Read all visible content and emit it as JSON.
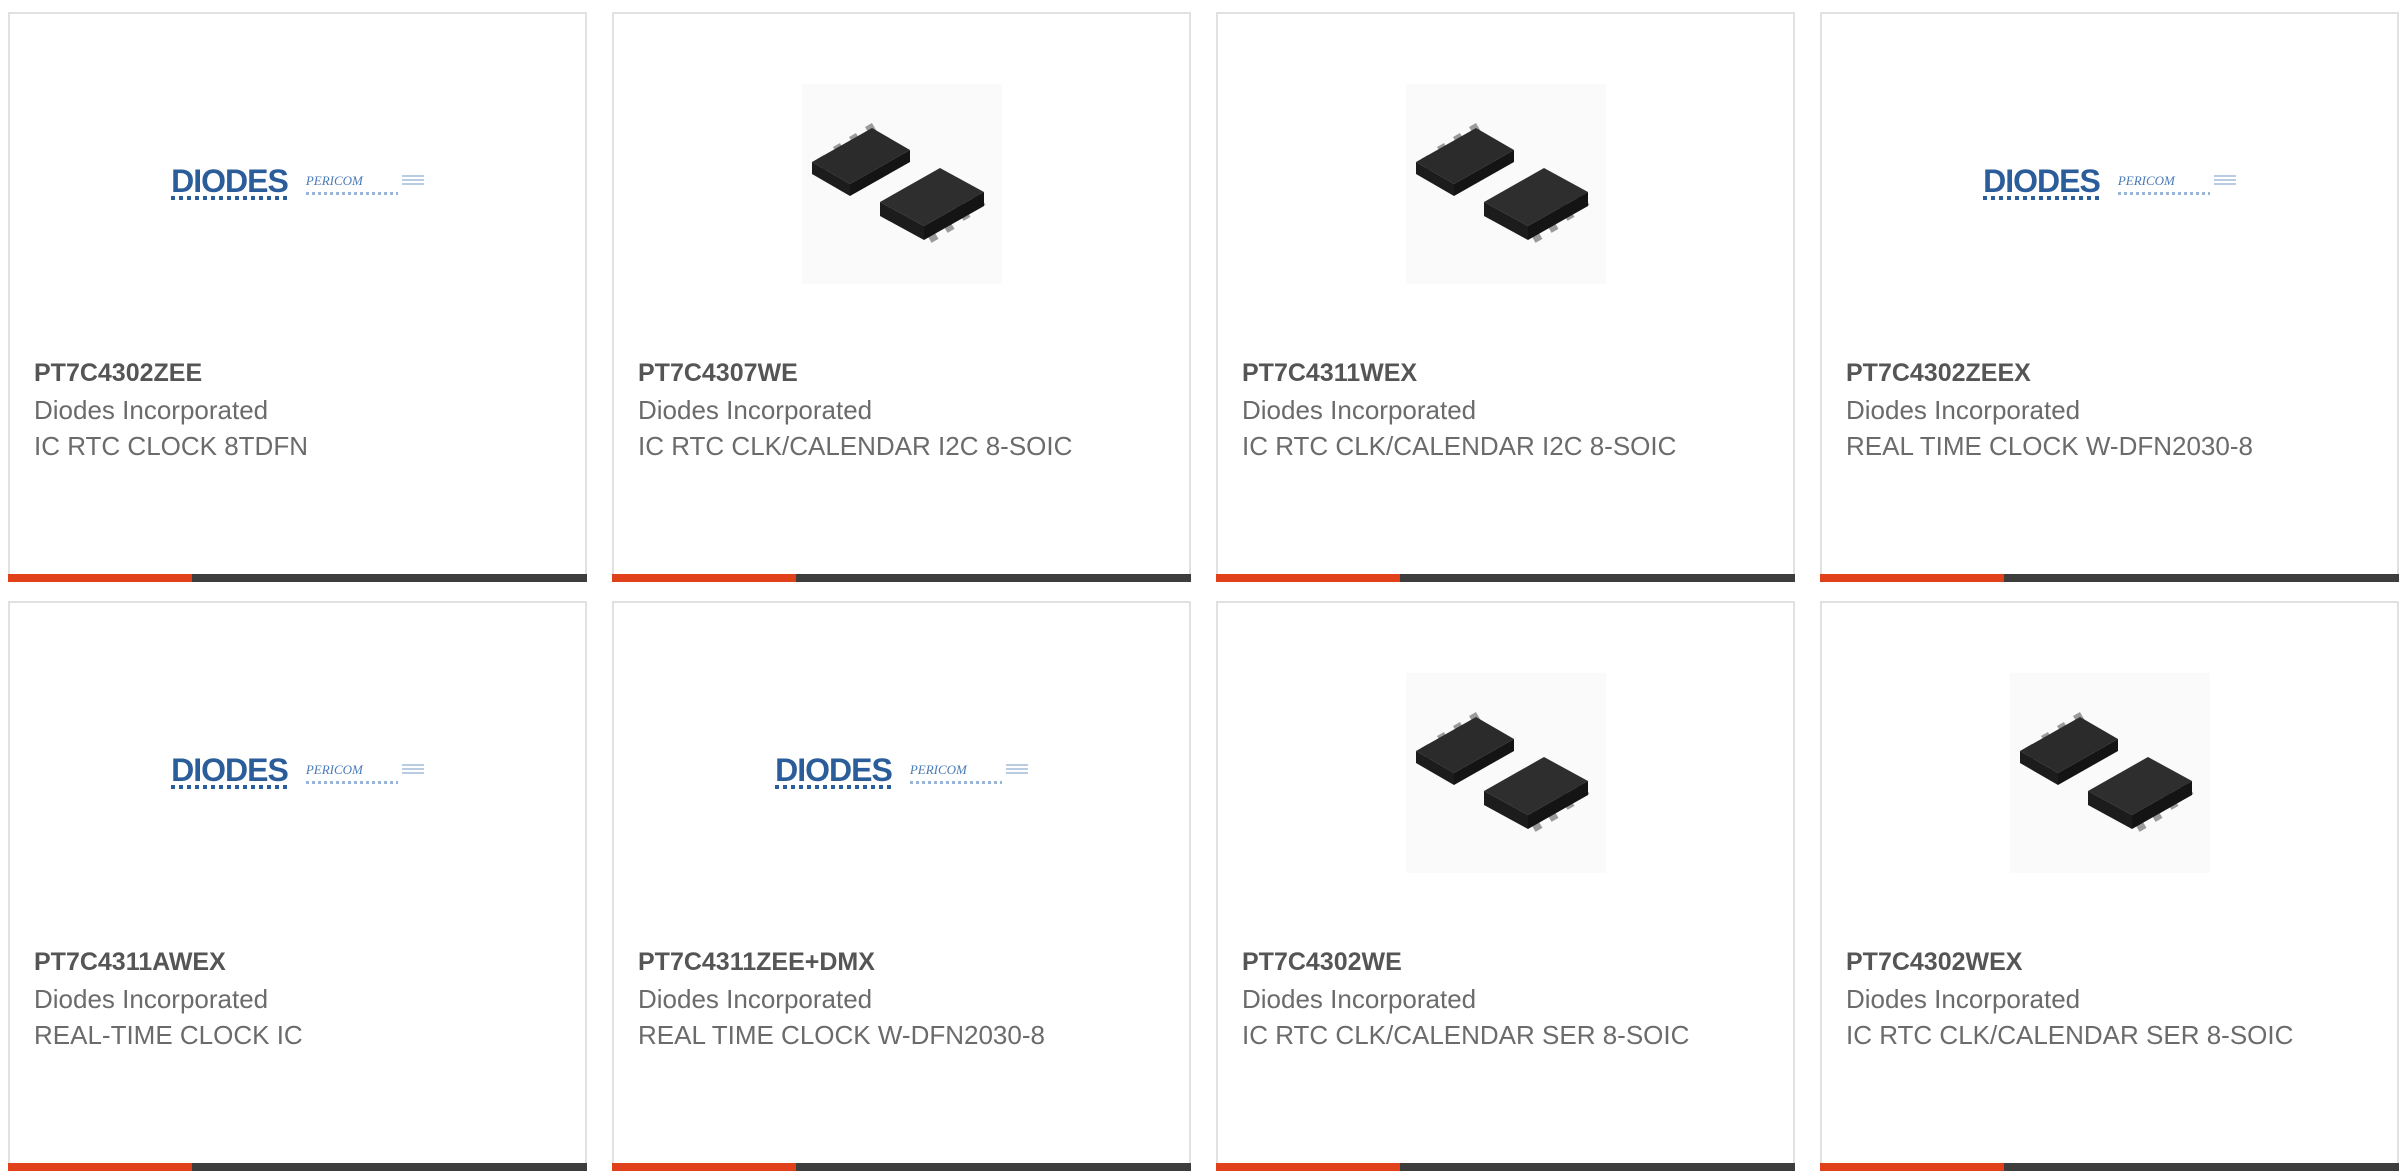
{
  "products": [
    {
      "part_number": "PT7C4302ZEE",
      "manufacturer": "Diodes Incorporated",
      "description": "IC RTC CLOCK 8TDFN",
      "image": "diodes-logo"
    },
    {
      "part_number": "PT7C4307WE",
      "manufacturer": "Diodes Incorporated",
      "description": "IC RTC CLK/CALENDAR I2C 8-SOIC",
      "image": "soic-chip"
    },
    {
      "part_number": "PT7C4311WEX",
      "manufacturer": "Diodes Incorporated",
      "description": "IC RTC CLK/CALENDAR I2C 8-SOIC",
      "image": "soic-chip"
    },
    {
      "part_number": "PT7C4302ZEEX",
      "manufacturer": "Diodes Incorporated",
      "description": "REAL TIME CLOCK W-DFN2030-8",
      "image": "diodes-logo"
    },
    {
      "part_number": "PT7C4311AWEX",
      "manufacturer": "Diodes Incorporated",
      "description": "REAL-TIME CLOCK IC",
      "image": "diodes-logo"
    },
    {
      "part_number": "PT7C4311ZEE+DMX",
      "manufacturer": "Diodes Incorporated",
      "description": "REAL TIME CLOCK W-DFN2030-8",
      "image": "diodes-logo"
    },
    {
      "part_number": "PT7C4302WE",
      "manufacturer": "Diodes Incorporated",
      "description": "IC RTC CLK/CALENDAR SER 8-SOIC",
      "image": "soic-chip"
    },
    {
      "part_number": "PT7C4302WEX",
      "manufacturer": "Diodes Incorporated",
      "description": "IC RTC CLK/CALENDAR SER 8-SOIC",
      "image": "soic-chip"
    }
  ],
  "logo": {
    "word": "DIODES",
    "partner": "PERICOM"
  },
  "colors": {
    "accent": "#e0401a",
    "bar": "#3d3d3d",
    "border": "#e1e1e1",
    "logo_blue": "#2a5d9a"
  }
}
